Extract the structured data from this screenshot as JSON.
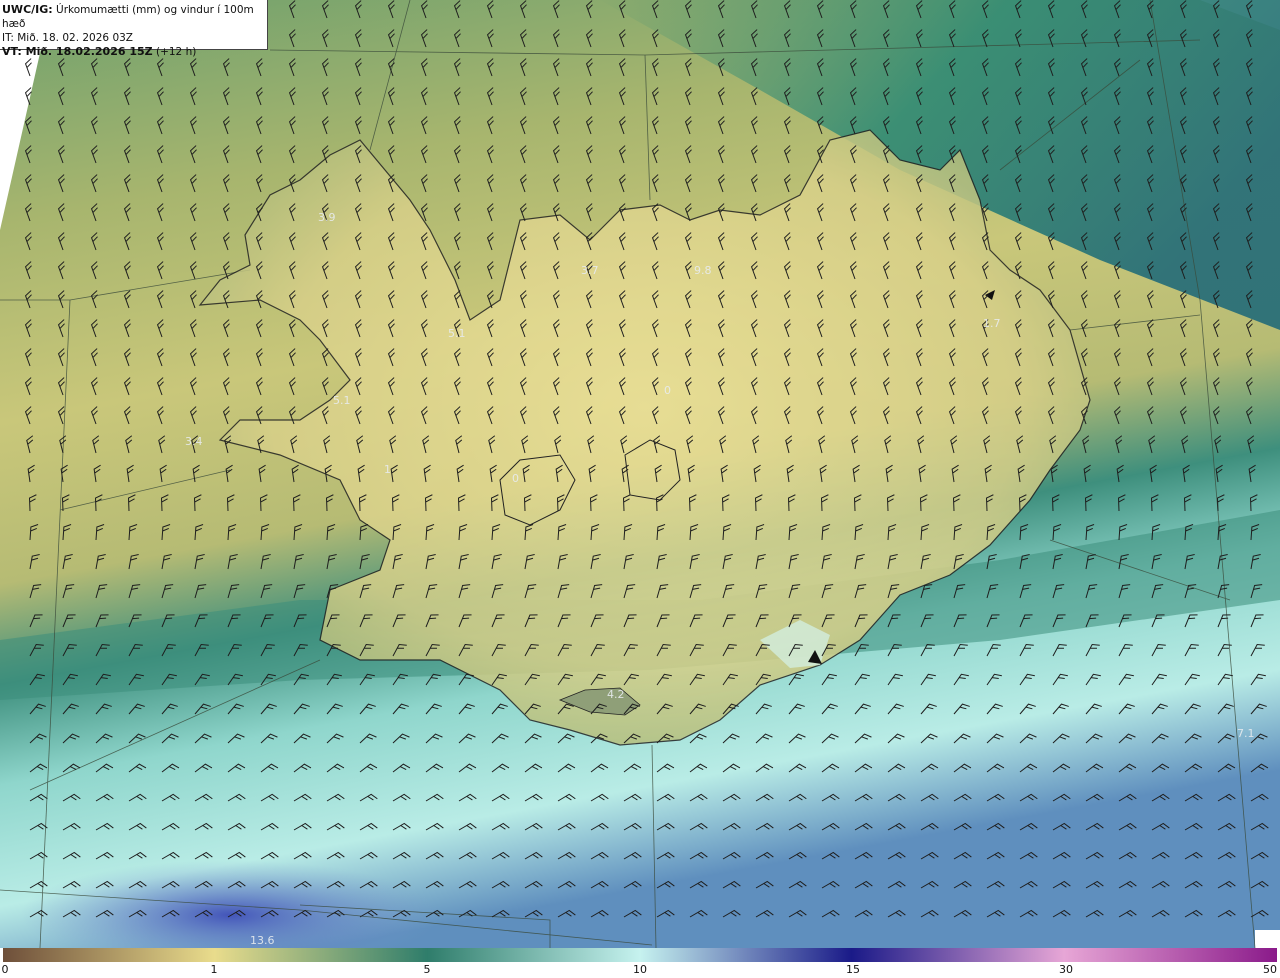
{
  "header": {
    "prefix": "UWC/IG:",
    "title": "Úrkomumætti (mm) og vindur í 100m hæð",
    "it_line": "IT: Mið. 18. 02. 2026 03Z",
    "vt_prefix": "VT: Mið. 18.02.2026 15Z",
    "vt_suffix": "(+12 h)"
  },
  "map_labels": [
    "3.9",
    "3.7",
    "9.8",
    "5.1",
    "1.7",
    "5.1",
    "3.4",
    "1",
    "0",
    "0",
    "4.2",
    "7.1",
    "13.6"
  ],
  "colorbar": {
    "ticks": [
      "0",
      "1",
      "5",
      "10",
      "15",
      "30",
      "50"
    ],
    "colors": {
      "c0": "#6e4f3a",
      "c1": "#e9dc8c",
      "c5": "#2f7d6b",
      "c10": "#c6f2ef",
      "c15": "#1a1a88",
      "c30": "#e7a6d6",
      "c50": "#8a1a8a"
    }
  },
  "icons": {
    "wind": "wind-barb-icon"
  }
}
